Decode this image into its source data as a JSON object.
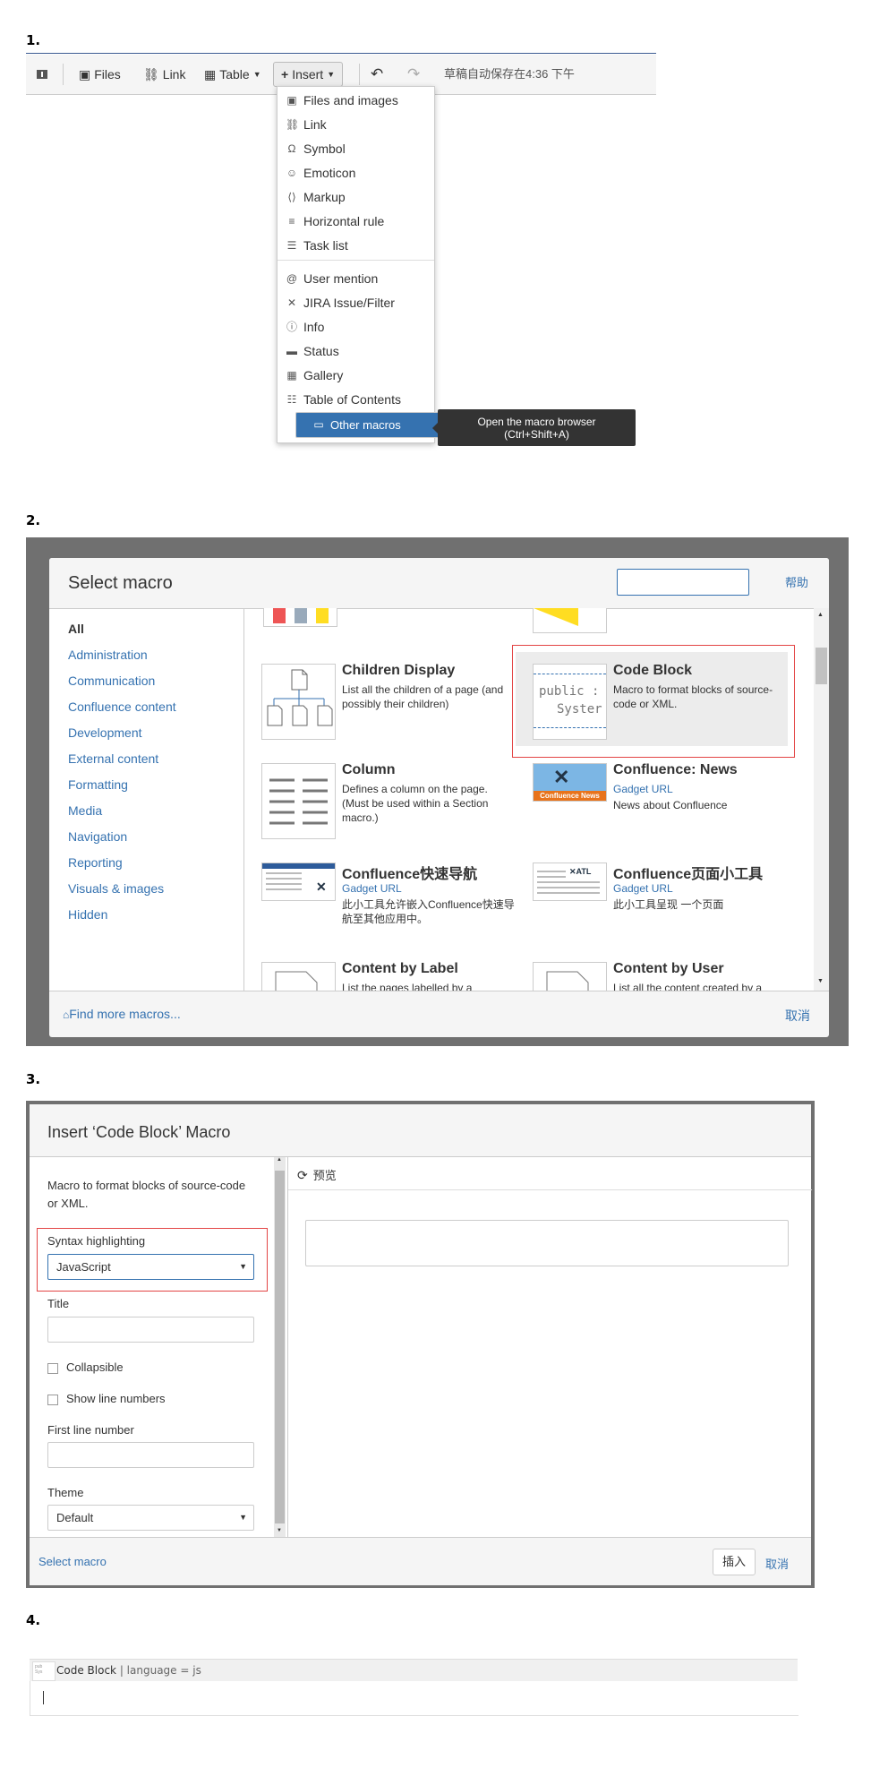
{
  "steps": [
    "1.",
    "2.",
    "3.",
    "4."
  ],
  "panel1": {
    "toolbar": {
      "files": "Files",
      "link": "Link",
      "table": "Table",
      "insert": "Insert",
      "autosave": "草稿自动保存在4:36 下午"
    },
    "menu": [
      {
        "label": "Files and images",
        "icon": "files-images-icon",
        "glyph": "▣"
      },
      {
        "label": "Link",
        "icon": "link-icon",
        "glyph": "⛓"
      },
      {
        "label": "Symbol",
        "icon": "omega-icon",
        "glyph": "Ω"
      },
      {
        "label": "Emoticon",
        "icon": "smiley-icon",
        "glyph": "☺"
      },
      {
        "label": "Markup",
        "icon": "markup-icon",
        "glyph": "⟨⟩"
      },
      {
        "label": "Horizontal rule",
        "icon": "horizontal-rule-icon",
        "glyph": "≡"
      },
      {
        "label": "Task list",
        "icon": "task-list-icon",
        "glyph": "☰"
      },
      {
        "label": "User mention",
        "icon": "at-icon",
        "glyph": "@"
      },
      {
        "label": "JIRA Issue/Filter",
        "icon": "jira-icon",
        "glyph": "✕"
      },
      {
        "label": "Info",
        "icon": "info-icon",
        "glyph": "ⓘ"
      },
      {
        "label": "Status",
        "icon": "status-icon",
        "glyph": "▬"
      },
      {
        "label": "Gallery",
        "icon": "gallery-icon",
        "glyph": "▦"
      },
      {
        "label": "Table of Contents",
        "icon": "toc-icon",
        "glyph": "☷"
      },
      {
        "label": "Other macros",
        "icon": "other-macros-icon",
        "glyph": "▭"
      }
    ],
    "tooltip": {
      "line1": "Open the macro browser",
      "line2": "(Ctrl+Shift+A)"
    }
  },
  "panel2": {
    "title": "Select macro",
    "help": "帮助",
    "categories": [
      "All",
      "Administration",
      "Communication",
      "Confluence content",
      "Development",
      "External content",
      "Formatting",
      "Media",
      "Navigation",
      "Reporting",
      "Visuals & images",
      "Hidden"
    ],
    "macros": {
      "children": {
        "name": "Children Display",
        "desc": "List all the children of a page (and possibly their children)"
      },
      "codeblock": {
        "name": "Code Block",
        "desc": "Macro to format blocks of source-code or XML.",
        "thumb1": "public :",
        "thumb2": "Syster"
      },
      "column": {
        "name": "Column",
        "desc": "Defines a column on the page. (Must be used within a Section macro.)"
      },
      "news": {
        "name": "Confluence: News",
        "gadget": "Gadget URL",
        "desc": "News about Confluence",
        "thumb": "Confluence News"
      },
      "quicknav": {
        "name": "Confluence快速导航",
        "gadget": "Gadget URL",
        "desc": "此小工具允许嵌入Confluence快速导航至其他应用中。"
      },
      "pagegadget": {
        "name": "Confluence页面小工具",
        "gadget": "Gadget URL",
        "desc": "此小工具呈现 一个页面"
      },
      "bylabel": {
        "name": "Content by Label",
        "desc": "List the pages labelled by a"
      },
      "byuser": {
        "name": "Content by User",
        "desc": "List all the content created by a"
      }
    },
    "findmore": "Find more macros...",
    "cancel": "取消"
  },
  "panel3": {
    "title": "Insert ‘Code Block’ Macro",
    "desc": "Macro to format blocks of source-code or XML.",
    "syntax_label": "Syntax highlighting",
    "syntax_value": "JavaScript",
    "title_label": "Title",
    "collapsible": "Collapsible",
    "linenumbers": "Show line numbers",
    "firstline_label": "First line number",
    "theme_label": "Theme",
    "theme_value": "Default",
    "preview": "预览",
    "select_macro": "Select macro",
    "insert": "插入",
    "cancel": "取消"
  },
  "panel4": {
    "name": "Code Block",
    "params": "| language = js"
  }
}
